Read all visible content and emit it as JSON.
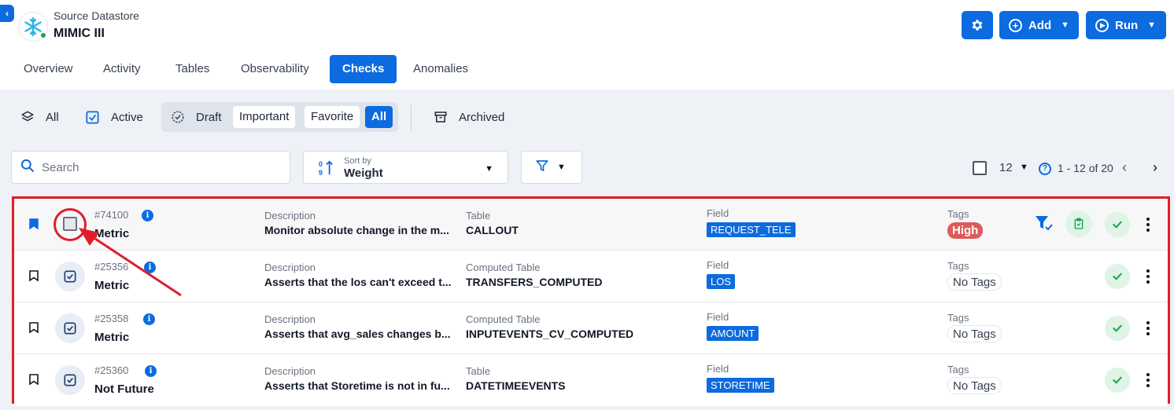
{
  "header": {
    "collapse_icon": "chevron-left-icon",
    "datastore_label": "Source Datastore",
    "datastore_name": "MIMIC III",
    "datastore_logo": "snowflake-icon",
    "status_color": "#16a34a",
    "add_label": "Add",
    "run_label": "Run"
  },
  "tabs": [
    {
      "label": "Overview"
    },
    {
      "label": "Activity"
    },
    {
      "label": "Tables"
    },
    {
      "label": "Observability"
    },
    {
      "label": "Checks",
      "active": true
    },
    {
      "label": "Anomalies"
    }
  ],
  "status_filters": {
    "all": "All",
    "active": "Active",
    "draft": "Draft",
    "important": "Important",
    "favorite": "Favorite",
    "all_selected": "All",
    "archived": "Archived"
  },
  "search": {
    "placeholder": "Search"
  },
  "sort": {
    "caption": "Sort by",
    "value": "Weight"
  },
  "pagination": {
    "per_page": "12",
    "range": "1 - 12 of 20"
  },
  "checks": [
    {
      "id": "#74100",
      "type": "Metric",
      "description_label": "Description",
      "description": "Monitor absolute change in the m...",
      "table_label": "Table",
      "table": "CALLOUT",
      "field_label": "Field",
      "field": "REQUEST_TELE",
      "tags_label": "Tags",
      "tag": "High",
      "bookmarked": true
    },
    {
      "id": "#25356",
      "type": "Metric",
      "description_label": "Description",
      "description": "Asserts that the los can't exceed t...",
      "table_label": "Computed Table",
      "table": "TRANSFERS_COMPUTED",
      "field_label": "Field",
      "field": "LOS",
      "tags_label": "Tags",
      "tag": "No Tags",
      "bookmarked": false
    },
    {
      "id": "#25358",
      "type": "Metric",
      "description_label": "Description",
      "description": "Asserts that avg_sales changes b...",
      "table_label": "Computed Table",
      "table": "INPUTEVENTS_CV_COMPUTED",
      "field_label": "Field",
      "field": "AMOUNT",
      "tags_label": "Tags",
      "tag": "No Tags",
      "bookmarked": false
    },
    {
      "id": "#25360",
      "type": "Not Future",
      "description_label": "Description",
      "description": "Asserts that Storetime is not in fu...",
      "table_label": "Table",
      "table": "DATETIMEEVENTS",
      "field_label": "Field",
      "field": "STORETIME",
      "tags_label": "Tags",
      "tag": "No Tags",
      "bookmarked": false
    }
  ],
  "colors": {
    "accent": "#0b6bdf",
    "highlight": "#e11d2a",
    "tag_high": "#e05a5a",
    "success": "#16a34a"
  }
}
